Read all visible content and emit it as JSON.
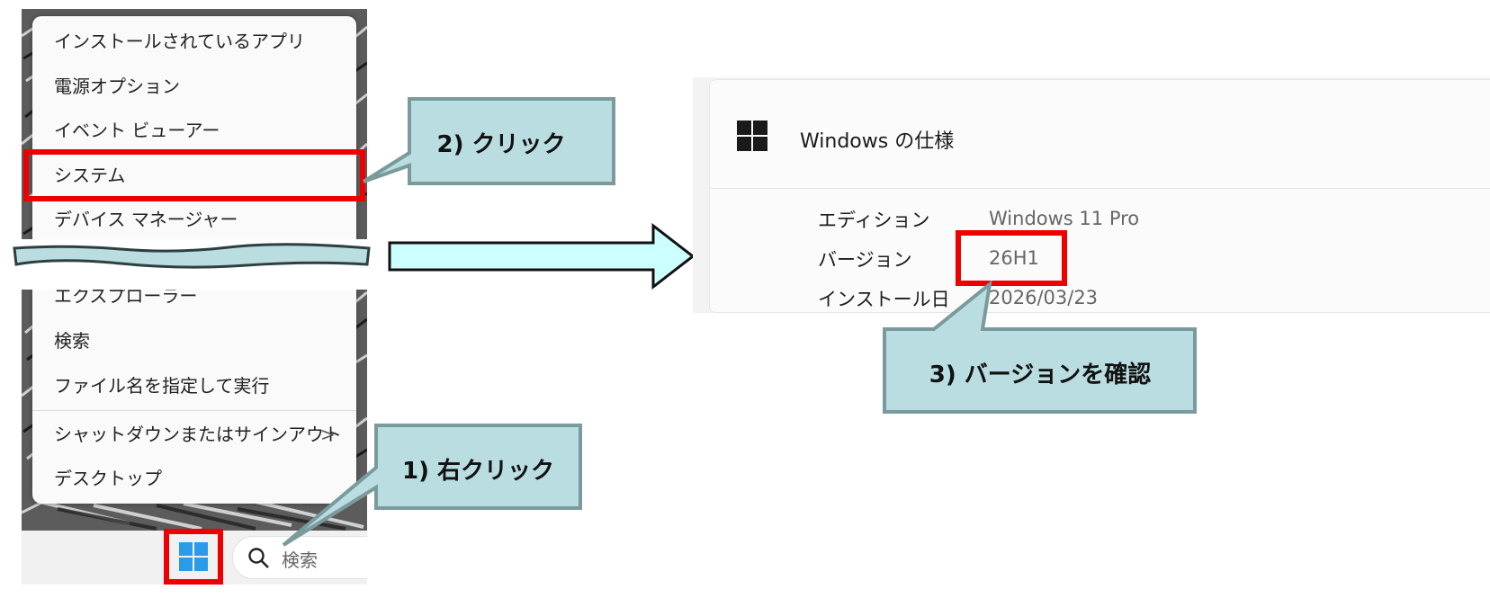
{
  "context_menu": {
    "items": [
      {
        "label": "インストールされているアプリ"
      },
      {
        "label": "電源オプション"
      },
      {
        "label": "イベント ビューアー"
      },
      {
        "label": "システム"
      },
      {
        "label": "デバイス マネージャー"
      },
      {
        "label": "エクスプローラー"
      },
      {
        "label": "検索"
      },
      {
        "label": "ファイル名を指定して実行"
      },
      {
        "label": "シャットダウンまたはサインアウト"
      },
      {
        "label": "デスクトップ"
      }
    ],
    "submenu_chevron": ">"
  },
  "taskbar": {
    "search_label": "検索"
  },
  "windows_spec": {
    "title": "Windows の仕様",
    "rows": [
      {
        "label": "エディション",
        "value": "Windows 11 Pro"
      },
      {
        "label": "バージョン",
        "value": "26H1"
      },
      {
        "label": "インストール日",
        "value": "2026/03/23"
      }
    ]
  },
  "callouts": {
    "step1": "1) 右クリック",
    "step2": "2) クリック",
    "step3": "3) バージョンを確認"
  },
  "colors": {
    "highlight": "#ee0000",
    "callout_fill": "#b9dde0",
    "callout_border": "#7a9a9c",
    "arrow_fill": "#ccffff",
    "windows_blue": "#2a9be8"
  }
}
